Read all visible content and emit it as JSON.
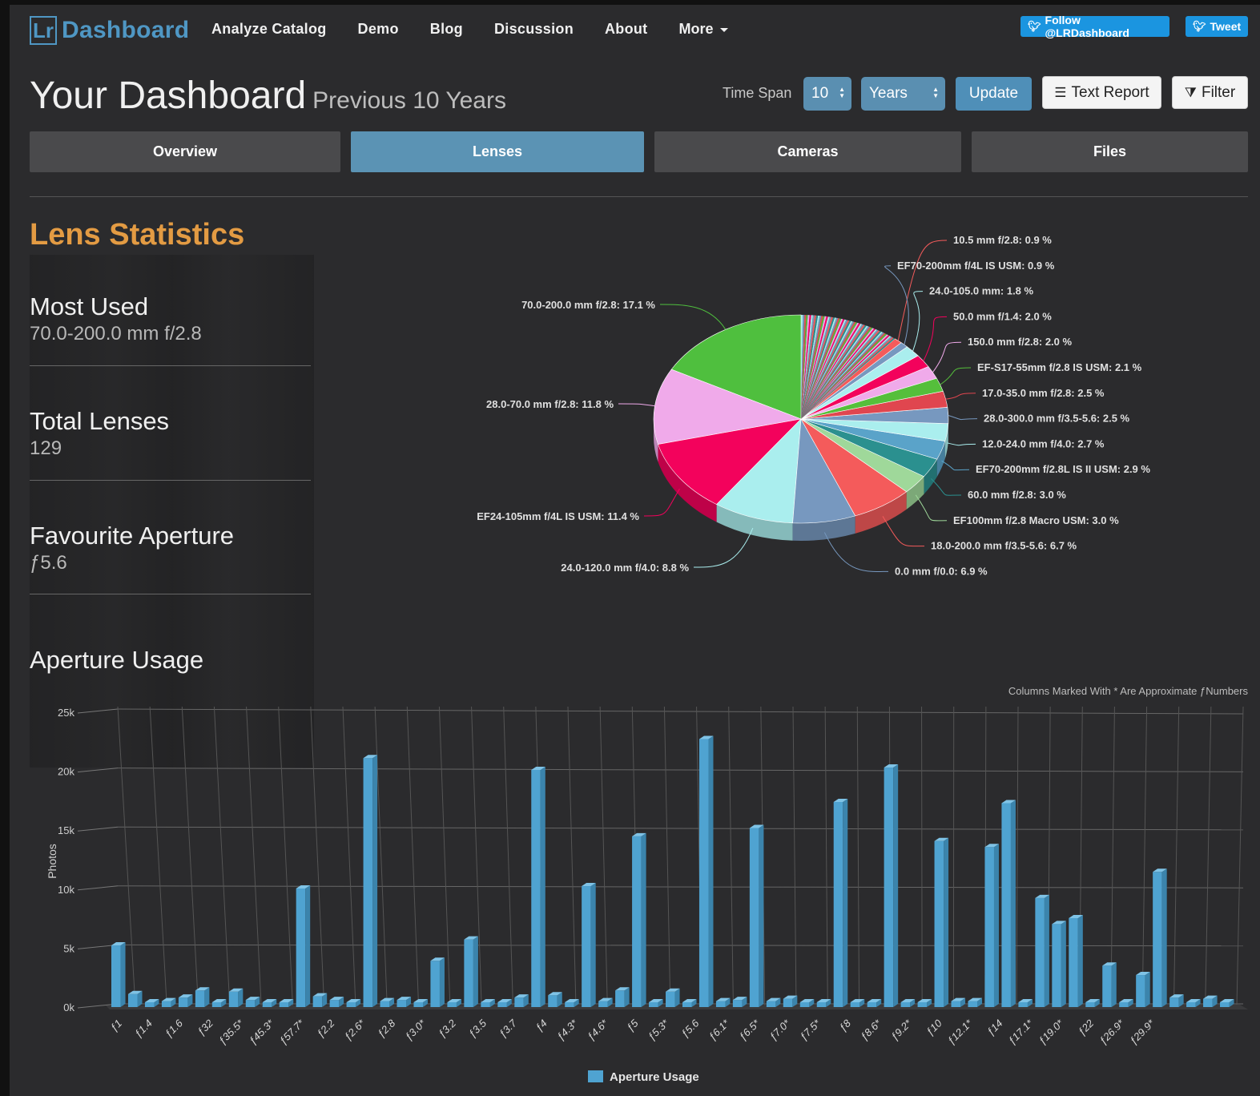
{
  "brand": {
    "lr": "Lr",
    "name": "Dashboard"
  },
  "nav": [
    "Analyze Catalog",
    "Demo",
    "Blog",
    "Discussion",
    "About",
    "More"
  ],
  "twitter": {
    "follow": "Follow @LRDashboard",
    "tweet": "Tweet"
  },
  "header": {
    "title": "Your Dashboard",
    "subtitle": "Previous 10 Years"
  },
  "controls": {
    "time_span_label": "Time Span",
    "span_value": "10",
    "unit_value": "Years",
    "update": "Update",
    "text_report": "Text Report",
    "filter": "Filter"
  },
  "tabs": [
    {
      "label": "Overview",
      "active": false
    },
    {
      "label": "Lenses",
      "active": true
    },
    {
      "label": "Cameras",
      "active": false
    },
    {
      "label": "Files",
      "active": false
    }
  ],
  "lens_stats": {
    "title": "Lens Statistics",
    "items": [
      {
        "label": "Most Used",
        "value": "70.0-200.0 mm f/2.8"
      },
      {
        "label": "Total Lenses",
        "value": "129"
      },
      {
        "label": "Favourite Aperture",
        "value": "ƒ5.6"
      }
    ]
  },
  "aperture_section": {
    "title": "Aperture Usage",
    "note": "Columns Marked With * Are Approximate ƒNumbers"
  },
  "colors": {
    "accent": "#4f97c4",
    "orange": "#e39b43",
    "bar": "#4fa3d1",
    "twitter": "#1b95e0"
  },
  "chart_data": [
    {
      "type": "pie",
      "slices": [
        {
          "label": "70.0-200.0 mm f/2.8",
          "value": 17.1,
          "color": "#4fbf3e"
        },
        {
          "label": "28.0-70.0 mm f/2.8",
          "value": 11.8,
          "color": "#f0aaea"
        },
        {
          "label": "EF24-105mm f/4L IS USM",
          "value": 11.4,
          "color": "#f3025c"
        },
        {
          "label": "24.0-120.0 mm f/4.0",
          "value": 8.8,
          "color": "#aaeeee"
        },
        {
          "label": "0.0 mm f/0.0",
          "value": 6.9,
          "color": "#7798bf"
        },
        {
          "label": "18.0-200.0 mm f/3.5-5.6",
          "value": 6.7,
          "color": "#f45b5b"
        },
        {
          "label": "EF100mm f/2.8 Macro USM",
          "value": 3.0,
          "color": "#9fd89a"
        },
        {
          "label": "60.0 mm f/2.8",
          "value": 3.0,
          "color": "#2b908f"
        },
        {
          "label": "EF70-200mm f/2.8L IS II USM",
          "value": 2.9,
          "color": "#5aa3c9"
        },
        {
          "label": "12.0-24.0 mm f/4.0",
          "value": 2.7,
          "color": "#aaeeee"
        },
        {
          "label": "28.0-300.0 mm f/3.5-5.6",
          "value": 2.5,
          "color": "#7798bf"
        },
        {
          "label": "17.0-35.0 mm f/2.8",
          "value": 2.5,
          "color": "#e0464f"
        },
        {
          "label": "EF-S17-55mm f/2.8 IS USM",
          "value": 2.1,
          "color": "#55bf3b"
        },
        {
          "label": "150.0 mm f/2.8",
          "value": 2.0,
          "color": "#f0aaea"
        },
        {
          "label": "50.0 mm f/1.4",
          "value": 2.0,
          "color": "#f3025c"
        },
        {
          "label": "24.0-105.0 mm",
          "value": 1.8,
          "color": "#aaeeee"
        },
        {
          "label": "EF70-200mm f/4L IS USM",
          "value": 0.9,
          "color": "#7798bf"
        },
        {
          "label": "10.5 mm f/2.8",
          "value": 0.9,
          "color": "#f45b5b"
        }
      ],
      "other_color_cycle": [
        "#2b908f",
        "#f45b5b",
        "#7798bf",
        "#aaeeee",
        "#ff0066",
        "#eeaaee",
        "#55bf3b",
        "#df5353",
        "#7798bf",
        "#aaeeee"
      ]
    },
    {
      "type": "bar",
      "ylabel": "Photos",
      "ylim": [
        0,
        25000
      ],
      "yticks": [
        "0k",
        "5k",
        "10k",
        "15k",
        "20k",
        "25k"
      ],
      "legend": "Aperture Usage",
      "tick_labels": [
        "ƒ1",
        "ƒ1.4",
        "ƒ1.6",
        "ƒ32",
        "ƒ35.5*",
        "ƒ45.3*",
        "ƒ57.7*",
        "ƒ2.2",
        "ƒ2.6*",
        "ƒ2.8",
        "ƒ3.0*",
        "ƒ3.2",
        "ƒ3.5",
        "ƒ3.7",
        "ƒ4",
        "ƒ4.3*",
        "ƒ4.6*",
        "ƒ5",
        "ƒ5.3*",
        "ƒ5.6",
        "ƒ6.1*",
        "ƒ6.5*",
        "ƒ7.0*",
        "ƒ7.5*",
        "ƒ8",
        "ƒ8.6*",
        "ƒ9.2*",
        "ƒ10",
        "ƒ12.1*",
        "ƒ14",
        "ƒ17.1*",
        "ƒ19.0*",
        "ƒ22",
        "ƒ26.9*",
        "ƒ29.9*"
      ],
      "values": [
        5200,
        1100,
        400,
        500,
        800,
        1400,
        300,
        1300,
        600,
        400,
        300,
        10000,
        900,
        600,
        400,
        21000,
        500,
        600,
        300,
        3900,
        300,
        5700,
        400,
        400,
        800,
        20000,
        1000,
        400,
        10200,
        500,
        1400,
        14400,
        400,
        1300,
        400,
        22600,
        500,
        600,
        15100,
        500,
        700,
        400,
        400,
        17300,
        400,
        400,
        20200,
        400,
        300,
        14000,
        500,
        500,
        13500,
        17200,
        400,
        9200,
        7000,
        7500,
        400,
        3500,
        400,
        2700,
        11400,
        800,
        300,
        700,
        400
      ]
    }
  ]
}
